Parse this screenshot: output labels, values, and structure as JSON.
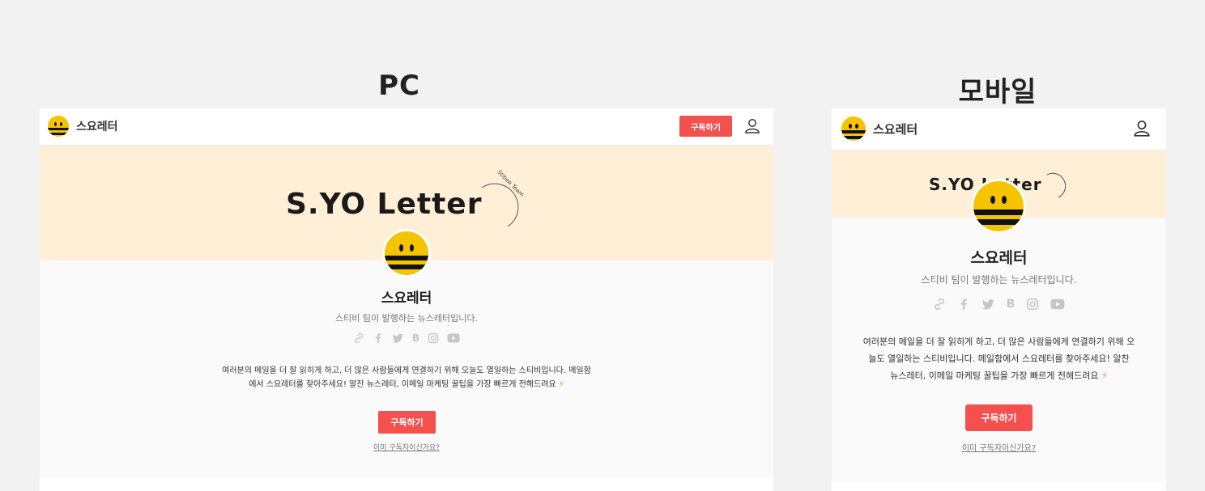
{
  "pc": {
    "section_title": "PC",
    "brand_name": "스요레터",
    "subscribe_label": "구독하기",
    "logo_text": "S.YO Letter",
    "logo_badge": "Stibee Team",
    "newsletter_name": "스요레터",
    "tagline": "스티비 팀이 발행하는 뉴스레터입니다.",
    "description_line1": "여러분의 메일을 더 잘 읽히게 하고, 더 많은 사람들에게 연결하기 위해 오늘도 열일하는 스티비입니다. 메일함",
    "description_line2": "에서 스요레터를 찾아주세요! 알찬 뉴스레터, 이메일 마케팅 꿀팁을 가장 빠르게 전해드려요",
    "cta_label": "구독하기",
    "already_link": "이미 구독자이신가요?"
  },
  "mobile": {
    "section_title": "모바일",
    "brand_name": "스요레터",
    "logo_text": "S.YO Letter",
    "newsletter_name": "스요레터",
    "tagline": "스티비 팀이 발행하는 뉴스레터입니다.",
    "description_line1": "여러분의 메일을 더 잘 읽히게 하고, 더 많은 사람들에게 연결하기 위해 오",
    "description_line2": "늘도 열일하는 스티비입니다. 메일함에서 스요레터를 찾아주세요! 알찬",
    "description_line3": "뉴스레터, 이메일 마케팅 꿀팁을 가장 빠르게 전해드려요",
    "cta_label": "구독하기",
    "already_link": "이미 구독자이신가요?"
  },
  "icons": [
    "link-icon",
    "facebook-icon",
    "twitter-icon",
    "blog-icon",
    "instagram-icon",
    "youtube-icon",
    "user-icon",
    "bolt-icon"
  ],
  "colors": {
    "accent": "#f4504e",
    "banner": "#ffefd6",
    "smiley": "#f5c400",
    "bolt": "#f28a1a"
  }
}
